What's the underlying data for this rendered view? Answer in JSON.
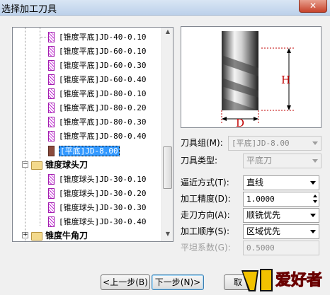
{
  "window": {
    "title": "选择加工刀具",
    "close_label": "✕"
  },
  "tree": {
    "items": [
      {
        "label": "[锥度平底]JD-40-0.10"
      },
      {
        "label": "[锥度平底]JD-60-0.10"
      },
      {
        "label": "[锥度平底]JD-60-0.30"
      },
      {
        "label": "[锥度平底]JD-60-0.40"
      },
      {
        "label": "[锥度平底]JD-80-0.10"
      },
      {
        "label": "[锥度平底]JD-80-0.20"
      },
      {
        "label": "[锥度平底]JD-80-0.30"
      },
      {
        "label": "[锥度平底]JD-80-0.40"
      },
      {
        "label": "[平底]JD-8.00"
      }
    ],
    "group_ball": "锥度球头刀",
    "ball_items": [
      {
        "label": "[锥度球头]JD-30-0.10"
      },
      {
        "label": "[锥度球头]JD-30-0.20"
      },
      {
        "label": "[锥度球头]JD-30-0.30"
      },
      {
        "label": "[锥度球头]JD-30-0.40"
      }
    ],
    "group_bull": "锥度牛角刀"
  },
  "preview": {
    "height_label": "H",
    "diameter_label": "D"
  },
  "form": {
    "tool_group_label": "刀具组(M):",
    "tool_group_value": "[平底]JD-8.00",
    "tool_type_label": "刀具类型:",
    "tool_type_value": "平底刀",
    "approach_label": "逼近方式(T):",
    "approach_value": "直线",
    "precision_label": "加工精度(D):",
    "precision_value": "1.0000",
    "direction_label": "走刀方向(A):",
    "direction_value": "顺铣优先",
    "order_label": "加工顺序(S):",
    "order_value": "区域优先",
    "smooth_label": "平坦系数(G):",
    "smooth_value": "0.5000"
  },
  "buttons": {
    "prev": "<上一步(B)",
    "next": "下一步(N)>",
    "cancel": "取"
  },
  "watermark": {
    "text": "爱好者"
  },
  "colors": {
    "selection": "#3399ff",
    "tool_icon": "#c026d3"
  }
}
